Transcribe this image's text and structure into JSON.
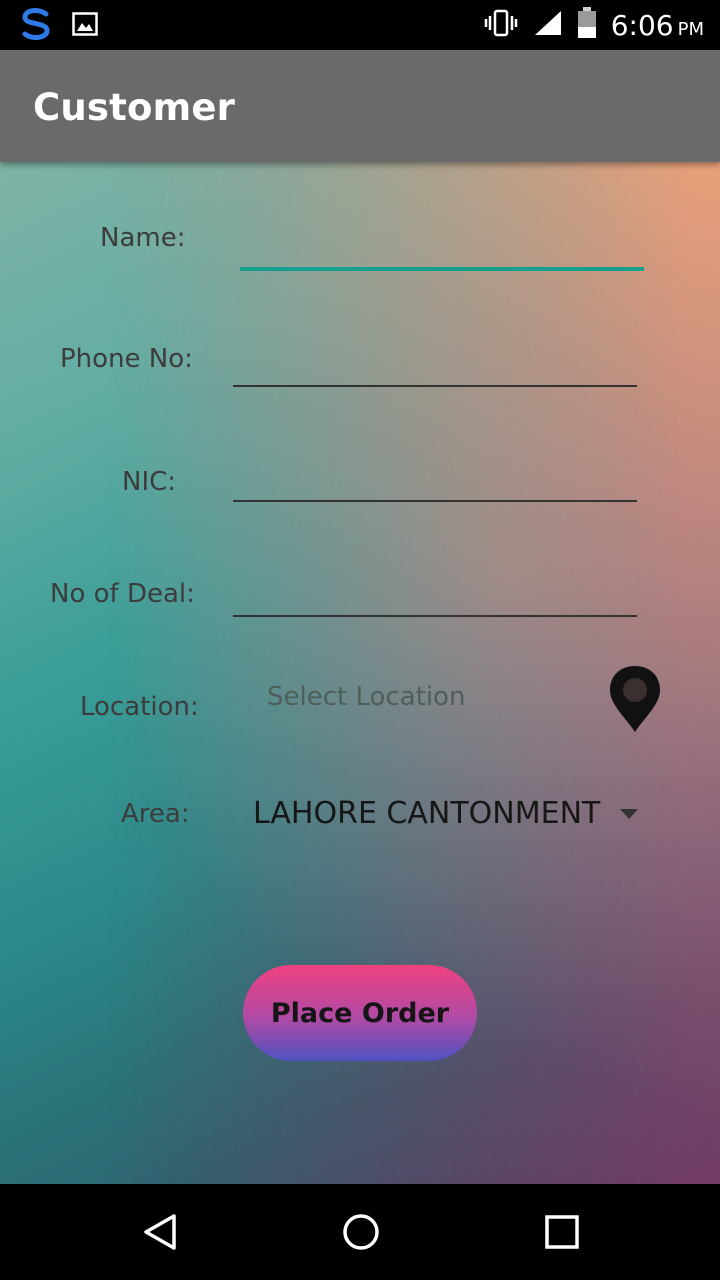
{
  "status_bar": {
    "time": "6:06",
    "ampm": "PM",
    "icons": [
      "swype-icon",
      "image-notification-icon",
      "vibrate-icon",
      "signal-icon",
      "battery-icon"
    ]
  },
  "app_bar": {
    "title": "Customer"
  },
  "form": {
    "name_label": "Name:",
    "name_value": "",
    "phone_label": "Phone No:",
    "phone_value": "",
    "nic_label": "NIC:",
    "nic_value": "",
    "deal_label": "No of Deal:",
    "deal_value": "",
    "location_label": "Location:",
    "location_placeholder": "Select Location",
    "area_label": "Area:",
    "area_value": "LAHORE CANTONMENT"
  },
  "actions": {
    "place_order_label": "Place Order"
  },
  "nav_bar": {
    "buttons": [
      "back-icon",
      "home-icon",
      "recents-icon"
    ]
  },
  "colors": {
    "accent": "#159f8c",
    "app_bar": "#6a6a6a",
    "button_top": "#f0417f",
    "button_bottom": "#4f52c0"
  }
}
